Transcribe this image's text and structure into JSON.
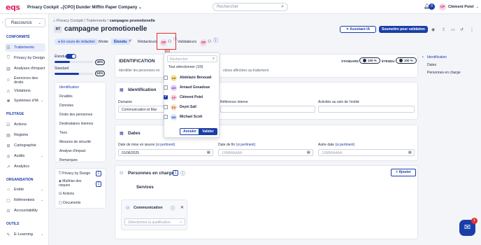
{
  "topbar": {
    "logo": "eqs",
    "product": "Privacy Cockpit",
    "company": "[CPO] Dunder Mifflin Paper Company",
    "search_placeholder": "Rechercher",
    "notif_count": "0",
    "user_initials": "CP",
    "user_name": "Clément Potel"
  },
  "sidebar": {
    "shortcuts": "Raccourcis",
    "sections": [
      {
        "title": "CONFORMITÉ",
        "items": [
          "Traitements",
          "Privacy by Design",
          "Analyses d'impact",
          "Exercices des droits",
          "Violations",
          "Systèmes d'IA"
        ]
      },
      {
        "title": "PILOTAGE",
        "items": [
          "Actions",
          "Registre",
          "Cartographie",
          "Audits",
          "Analytics"
        ]
      },
      {
        "title": "ORGANISATION",
        "items": [
          "Entité",
          "Référentiels",
          "Accountability"
        ]
      },
      {
        "title": "OUTILS",
        "items": [
          "E-Learning"
        ]
      }
    ]
  },
  "breadcrumb": {
    "items": [
      "Privacy Cockpit",
      "Traitements"
    ],
    "current": "campagne promotionelle"
  },
  "page": {
    "code": "RT",
    "title": "campagne promotionelle",
    "status": "En cours de rédaction",
    "mode_label": "Mode",
    "mode_value": "Étendu",
    "redacteurs_label": "Rédacteurs",
    "validateurs_label": "Validateurs",
    "assistant_btn": "Assistant IA",
    "submit_btn": "Soumettre pour validation"
  },
  "progress": {
    "etendu_label": "Étendu",
    "standard_label": "Standard",
    "etendu_pct": "40%",
    "etendu_value": 0.4,
    "standard_pct": "63%",
    "standard_value": 0.63
  },
  "left_menu": {
    "items": [
      "Identification",
      "Finalités",
      "Données",
      "Droits des personnes",
      "Destinataires internes",
      "Tiers",
      "Mesures de sécurité",
      "Analyse d'impact",
      "Remarques"
    ]
  },
  "left_menu2": {
    "items": [
      {
        "label": "Privacy by Design",
        "count": "1"
      },
      {
        "label": "Maîtrise des risques",
        "count": "1"
      },
      {
        "label": "Actions",
        "count": ""
      },
      {
        "label": "Documents",
        "count": ""
      }
    ]
  },
  "identification_card": {
    "title": "IDENTIFICATION",
    "desc": "Identifier les personnes en",
    "desc2": "ctions affectées au traitement",
    "standard_label": "STANDARD",
    "standard_pct": "100 %",
    "etendu_label": "ÉTENDU",
    "etendu_pct": "100 %"
  },
  "ident_card": {
    "title": "Identification",
    "domaine_label": "Domaine",
    "domaine_value": "Communication et Mar",
    "ref_label": "Référence interne",
    "activite_label": "Activités au sein de l'entité"
  },
  "dates_card": {
    "title": "Dates",
    "start_label": "Date de mise en œuvre",
    "start_opt": "(si pertinent)",
    "start_value": "01/06/2025",
    "end_label": "Date de fin",
    "end_opt": "(si pertinent)",
    "end_placeholder": "JJ/MM/AAAA",
    "other_label": "Autre date",
    "other_opt": "(si pertinent)",
    "other_placeholder": "JJ/MM/AAAA"
  },
  "personnes_card": {
    "title": "Personnes en charge",
    "count": "1",
    "add_btn": "Ajouter",
    "services_label": "Services",
    "service_name": "Communication",
    "qualif_placeholder": "Sélectionner la qualification"
  },
  "right_nav": {
    "items": [
      "Identification",
      "Dates",
      "Personnes en charge"
    ]
  },
  "dropdown": {
    "search_placeholder": "Rechercher",
    "all_label": "Tout sélectionner (1/9)",
    "users": [
      {
        "initials": "AB",
        "name": "Abdelaziz Benouali",
        "checked": false,
        "color": "#f4e3a1"
      },
      {
        "initials": "AG",
        "name": "Arnaud Gosadoue",
        "checked": false,
        "color": "#e3d3f3"
      },
      {
        "initials": "CP",
        "name": "Clément Potel",
        "checked": true,
        "color": "#f6d4e3"
      },
      {
        "initials": "DS",
        "name": "Deyni Sall",
        "checked": false,
        "color": "#f8dcc2"
      },
      {
        "initials": "MS",
        "name": "Michael Scott",
        "checked": false,
        "color": "#d9e4f5"
      }
    ],
    "cancel_btn": "Annuler",
    "confirm_btn": "Valider"
  },
  "chat": {
    "badge": "1"
  },
  "colors": {
    "accent": "#1a3ea8",
    "brand": "#e0245e",
    "annotation": "#e23030"
  }
}
